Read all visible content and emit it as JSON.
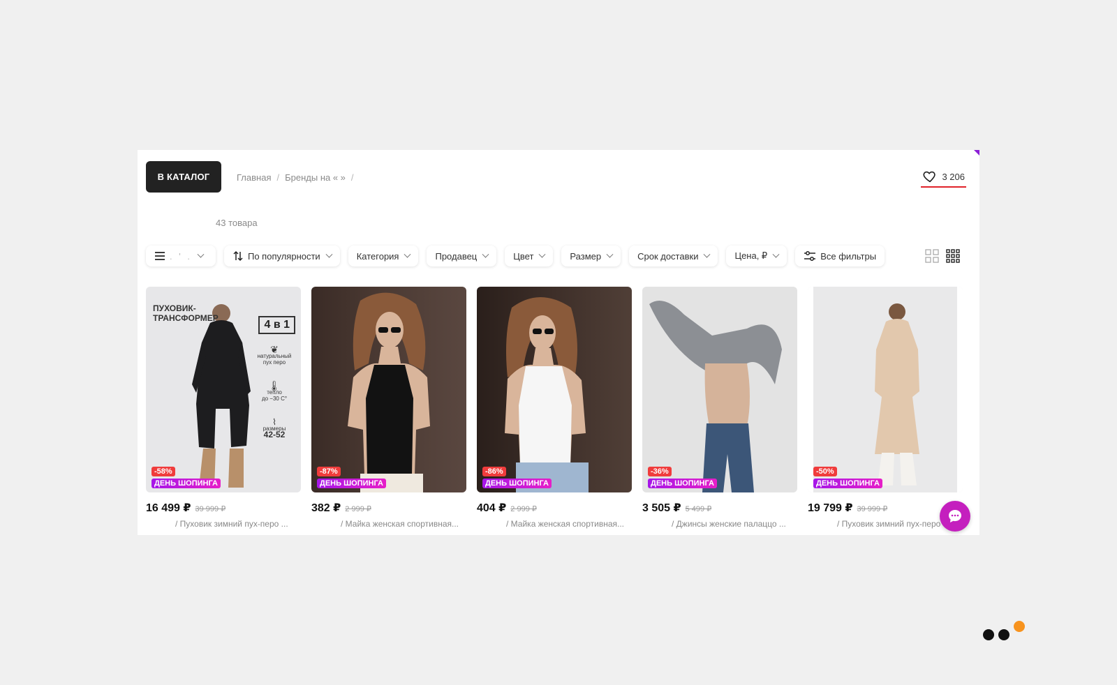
{
  "header": {
    "catalog_button": "В КАТАЛОГ",
    "breadcrumb": [
      "Главная",
      "Бренды на « »"
    ],
    "favorites_count": "3 206"
  },
  "listing": {
    "count_label": "43 товара"
  },
  "filters": {
    "menu_label": ". ' .",
    "sort_label": "По популярности",
    "items": [
      "Категория",
      "Продавец",
      "Цвет",
      "Размер",
      "Срок доставки",
      "Цена, ₽"
    ],
    "all_filters": "Все фильтры"
  },
  "products": [
    {
      "price": "16 499 ₽",
      "old_price": "39 999 ₽",
      "discount": "-58%",
      "promo": "ДЕНЬ ШОПИНГА",
      "title": "/ Пуховик зимний пух-перо ...",
      "art": {
        "headline": "ПУХОВИК-\nТРАНСФОРМЕР",
        "badge": "4 в 1",
        "feature1": "натуральный пух перо",
        "feature2_top": "тепло",
        "feature2_val": "до −30 С°",
        "feature3_top": "размеры",
        "feature3_val": "42-52"
      }
    },
    {
      "price": "382 ₽",
      "old_price": "2 999 ₽",
      "discount": "-87%",
      "promo": "ДЕНЬ ШОПИНГА",
      "title": "/ Майка женская спортивная..."
    },
    {
      "price": "404 ₽",
      "old_price": "2 999 ₽",
      "discount": "-86%",
      "promo": "ДЕНЬ ШОПИНГА",
      "title": "/ Майка женская спортивная..."
    },
    {
      "price": "3 505 ₽",
      "old_price": "5 499 ₽",
      "discount": "-36%",
      "promo": "ДЕНЬ ШОПИНГА",
      "title": "/ Джинсы женские палаццо ..."
    },
    {
      "price": "19 799 ₽",
      "old_price": "39 999 ₽",
      "discount": "-50%",
      "promo": "ДЕНЬ ШОПИНГА",
      "title": "/ Пуховик зимний пух-перо"
    }
  ],
  "colors": {
    "accent": "#c41fbe",
    "discount": "#f03c3c",
    "underline": "#e0222a"
  }
}
